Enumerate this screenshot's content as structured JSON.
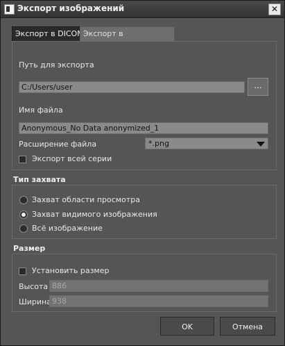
{
  "window": {
    "title": "Экспорт изображений",
    "close_label": "✕"
  },
  "tabs": [
    {
      "label": "Экспорт в DICOM",
      "active": true
    },
    {
      "label": "Экспорт в изображение",
      "active": false
    }
  ],
  "export": {
    "path_label": "Путь для экспорта",
    "path_value": "C:/Users/user",
    "browse_label": "...",
    "filename_label": "Имя файла",
    "filename_value": "Anonymous_No Data anonymized_1",
    "extension_label": "Расширение файла",
    "extension_value": "*.png",
    "export_series_label": "Экспорт всей серии",
    "export_series_checked": false
  },
  "capture": {
    "title": "Тип захвата",
    "options": [
      {
        "label": "Захват области просмотра",
        "checked": false
      },
      {
        "label": "Захват видимого изображения",
        "checked": true
      },
      {
        "label": "Всё изображение",
        "checked": false
      }
    ]
  },
  "size": {
    "title": "Размер",
    "set_size_label": "Установить размер",
    "set_size_checked": false,
    "height_label": "Высота",
    "height_value": "886",
    "width_label": "Ширина",
    "width_value": "938"
  },
  "buttons": {
    "ok": "OK",
    "cancel": "Отмена"
  }
}
